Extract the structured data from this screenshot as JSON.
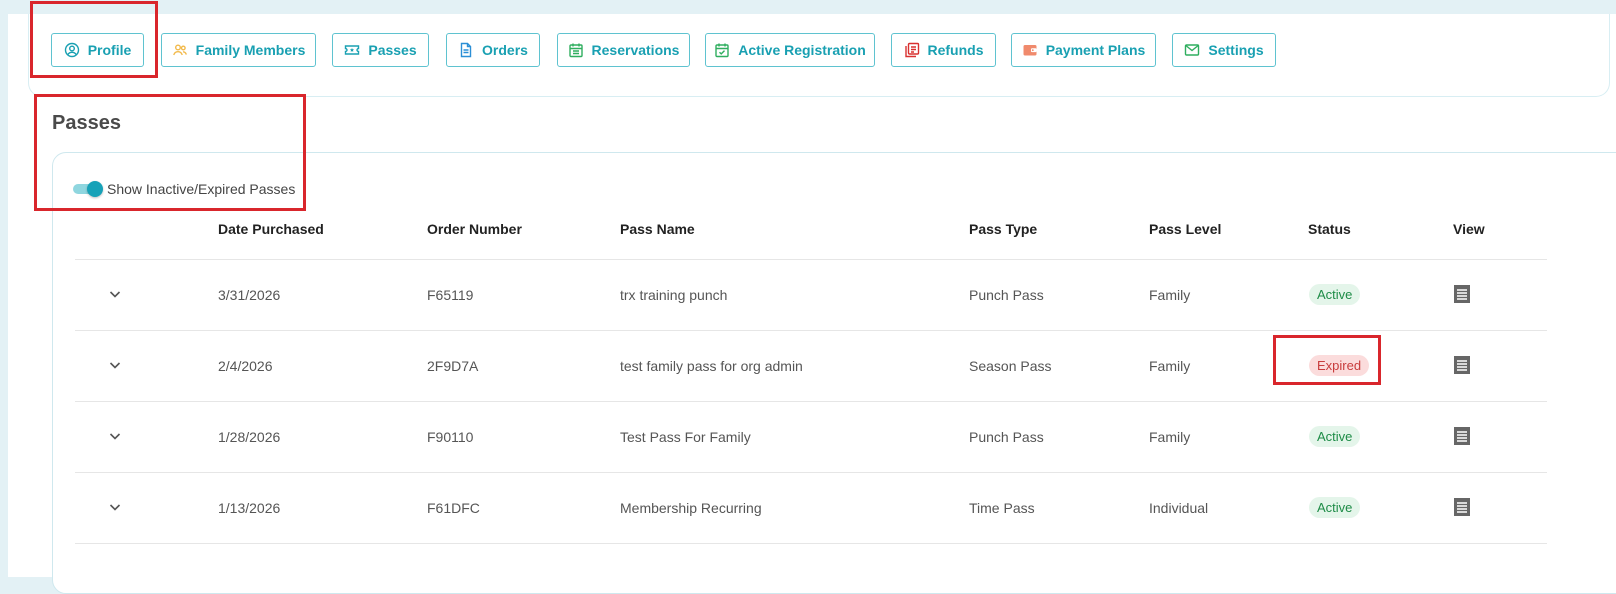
{
  "tabs": [
    {
      "label": "Profile",
      "icon": "user-circle-icon",
      "color": "#19a0b2"
    },
    {
      "label": "Family Members",
      "icon": "users-icon",
      "color": "#f2b94a"
    },
    {
      "label": "Passes",
      "icon": "ticket-icon",
      "color": "#19a0b2"
    },
    {
      "label": "Orders",
      "icon": "document-icon",
      "color": "#2b8fd6"
    },
    {
      "label": "Reservations",
      "icon": "calendar-list-icon",
      "color": "#2fae5f"
    },
    {
      "label": "Active Registration",
      "icon": "calendar-check-icon",
      "color": "#2fae5f"
    },
    {
      "label": "Refunds",
      "icon": "refund-icon",
      "color": "#d9302f"
    },
    {
      "label": "Payment Plans",
      "icon": "wallet-icon",
      "color": "#f08a6c"
    },
    {
      "label": "Settings",
      "icon": "envelope-icon",
      "color": "#2fae5f"
    }
  ],
  "section": {
    "title": "Passes"
  },
  "toggle": {
    "label": "Show Inactive/Expired Passes",
    "on": true
  },
  "table": {
    "headers": [
      "Date Purchased",
      "Order Number",
      "Pass Name",
      "Pass Type",
      "Pass Level",
      "Status",
      "View"
    ],
    "rows": [
      {
        "date": "3/31/2026",
        "order": "F65119",
        "name": "trx training punch",
        "type": "Punch Pass",
        "level": "Family",
        "status": "Active"
      },
      {
        "date": "2/4/2026",
        "order": "2F9D7A",
        "name": "test family pass for org admin",
        "type": "Season Pass",
        "level": "Family",
        "status": "Expired"
      },
      {
        "date": "1/28/2026",
        "order": "F90110",
        "name": "Test Pass For Family",
        "type": "Punch Pass",
        "level": "Family",
        "status": "Active"
      },
      {
        "date": "1/13/2026",
        "order": "F61DFC",
        "name": "Membership Recurring",
        "type": "Time Pass",
        "level": "Individual",
        "status": "Active"
      }
    ]
  },
  "colors": {
    "accent": "#19a0b2",
    "highlight": "#d9262c",
    "active": "#1e8c47",
    "expired": "#c83c3c"
  }
}
